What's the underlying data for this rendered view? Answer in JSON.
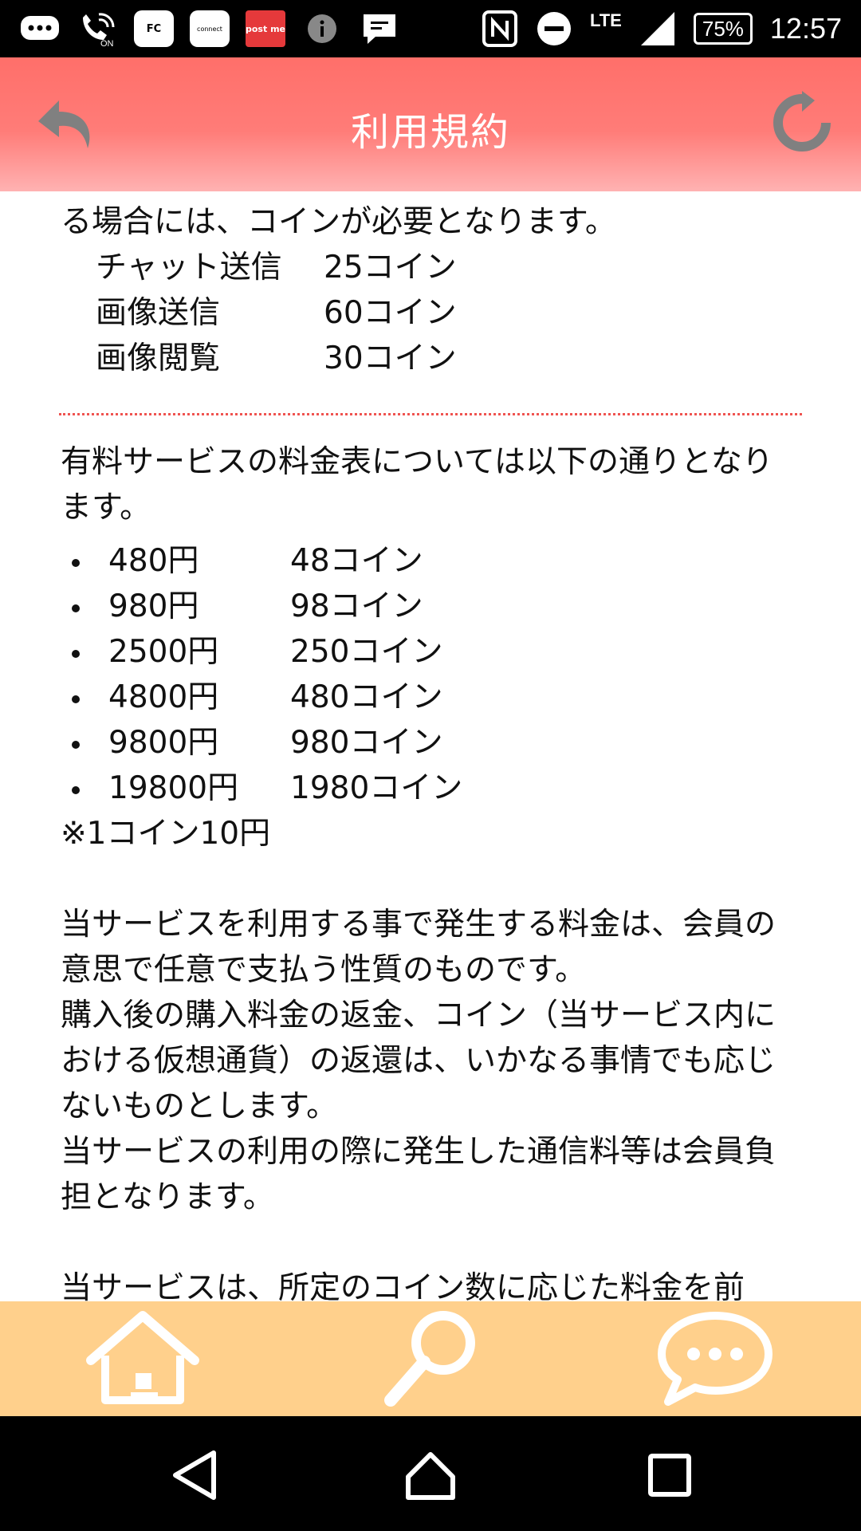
{
  "status_bar": {
    "battery": "75%",
    "network": "LTE",
    "time": "12:57",
    "notification_icons": [
      "message-icon",
      "wifi-calling-icon",
      "fc-app-icon",
      "connect-app-icon",
      "postme-app-icon",
      "info-icon",
      "feedback-icon"
    ],
    "fc_label": "FC",
    "postme_label": "post me",
    "connect_label": "connect"
  },
  "header": {
    "title": "利用規約",
    "back_icon": "back-arrow-icon",
    "refresh_icon": "refresh-icon",
    "colors": {
      "top": "#ff6f6a",
      "bottom": "#ffb2b2",
      "icon": "#808080"
    }
  },
  "content": {
    "intro_tail": "る場合には、コインが必要となります。",
    "usage_costs": [
      {
        "name": "チャット送信",
        "cost": "25コイン"
      },
      {
        "name": "画像送信",
        "cost": "60コイン"
      },
      {
        "name": "画像閲覧",
        "cost": "30コイン"
      }
    ],
    "divider_color": "#ef5350",
    "price_intro": "有料サービスの料金表については以下の通りとなります。",
    "price_list": [
      {
        "yen": "480円",
        "coins": "48コイン"
      },
      {
        "yen": "980円",
        "coins": "98コイン"
      },
      {
        "yen": "2500円",
        "coins": "250コイン"
      },
      {
        "yen": "4800円",
        "coins": "480コイン"
      },
      {
        "yen": "9800円",
        "coins": "980コイン"
      },
      {
        "yen": "19800円",
        "coins": "1980コイン"
      }
    ],
    "price_note": "※1コイン10円",
    "paragraphs": [
      "当サービスを利用する事で発生する料金は、会員の意思で任意で支払う性質のものです。",
      "購入後の購入料金の返金、コイン（当サービス内における仮想通貨）の返還は、いかなる事情でも応じないものとします。",
      "当サービスの利用の際に発生した通信料等は会員負担となります。"
    ],
    "cut_off_line": "当サービスは、所定のコイン数に応じた料金を前"
  },
  "tab_bar": {
    "background": "#ffd08c",
    "tabs": [
      "home-icon",
      "search-icon",
      "chat-icon"
    ]
  },
  "nav_bar": {
    "buttons": [
      "nav-back-icon",
      "nav-home-icon",
      "nav-recents-icon"
    ]
  }
}
